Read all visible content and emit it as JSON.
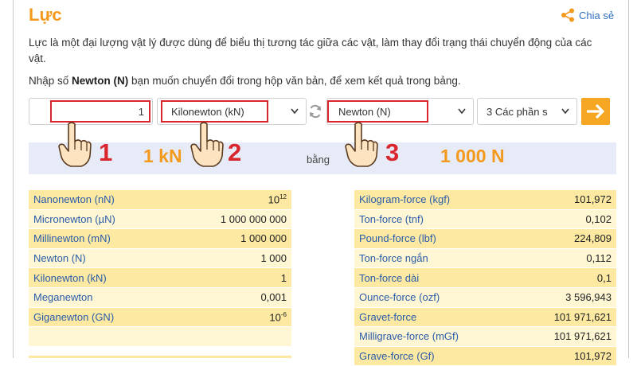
{
  "header": {
    "title": "Lực",
    "share_label": "Chia sẻ",
    "description": "Lực là một đại lượng vật lý được dùng để biểu thị tương tác giữa các vật, làm thay đổi trạng thái chuyển động của các vật.",
    "prompt_pre": "Nhập số ",
    "prompt_bold": "Newton (N)",
    "prompt_post": " bạn muốn chuyển đổi trong hộp văn bản, để xem kết quả trong bảng."
  },
  "converter": {
    "input_value": "1",
    "from_unit": "Kilonewton (kN)",
    "to_unit": "Newton (N)",
    "precision": "3 Các phần s",
    "go_icon": "arrow-right-icon",
    "swap_icon": "refresh-icon"
  },
  "result": {
    "from_display": "1 kN",
    "equals": "bằng",
    "to_display": "1 000 N"
  },
  "annotations": {
    "step1": "1",
    "step2": "2",
    "step3": "3",
    "accent": "#d9262d",
    "orange": "#f39a1e"
  },
  "left_table": [
    {
      "unit": "Nanonewton (nN)",
      "base": "10",
      "exp": "12"
    },
    {
      "unit": "Micronewton (µN)",
      "value": "1 000 000 000"
    },
    {
      "unit": "Millinewton (mN)",
      "value": "1 000 000"
    },
    {
      "unit": "Newton (N)",
      "value": "1 000"
    },
    {
      "unit": "Kilonewton (kN)",
      "value": "1"
    },
    {
      "unit": "Meganewton",
      "value": "0,001"
    },
    {
      "unit": "Giganewton (GN)",
      "base": "10",
      "exp": "-6"
    },
    {
      "unit": "",
      "value": ""
    }
  ],
  "right_table": [
    {
      "unit": "Kilogram-force (kgf)",
      "value": "101,972"
    },
    {
      "unit": "Ton-force (tnf)",
      "value": "0,102"
    },
    {
      "unit": "Pound-force (lbf)",
      "value": "224,809"
    },
    {
      "unit": "Ton-force ngắn",
      "value": "0,112"
    },
    {
      "unit": "Ton-force dài",
      "value": "0,1"
    },
    {
      "unit": "Ounce-force (ozf)",
      "value": "3 596,943"
    },
    {
      "unit": "Gravet-force",
      "value": "101 971,621"
    },
    {
      "unit": "Milligrave-force (mGf)",
      "value": "101 971,621"
    },
    {
      "unit": "Grave-force (Gf)",
      "value": "101,972"
    }
  ]
}
